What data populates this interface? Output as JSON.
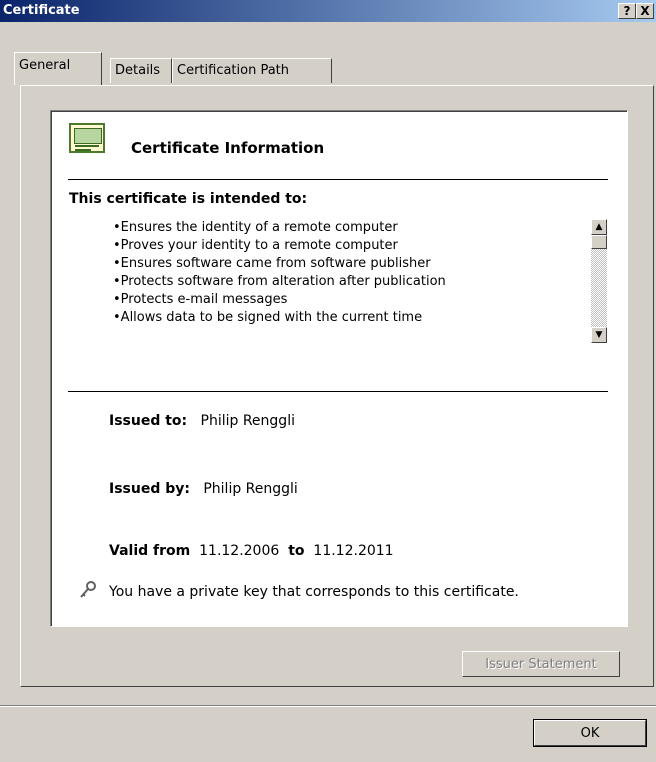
{
  "window": {
    "title": "Certificate",
    "help_label": "?",
    "close_label": "X"
  },
  "tabs": [
    {
      "label": "General"
    },
    {
      "label": "Details"
    },
    {
      "label": "Certification Path"
    }
  ],
  "general": {
    "heading": "Certificate Information",
    "intended_heading": "This certificate is intended to:",
    "purposes": [
      "Ensures the identity of a remote computer",
      "Proves your identity to a remote computer",
      "Ensures software came from software publisher",
      "Protects software from alteration after publication",
      "Protects e-mail messages",
      "Allows data to be signed with the current time"
    ],
    "issued_to_label": "Issued to:",
    "issued_to_value": "Philip Renggli",
    "issued_by_label": "Issued by:",
    "issued_by_value": "Philip Renggli",
    "valid_from_label": "Valid from",
    "valid_from_value": "11.12.2006",
    "valid_to_label": "to",
    "valid_to_value": "11.12.2011",
    "private_key_note": "You have a private key that corresponds to this certificate."
  },
  "buttons": {
    "issuer_statement": "Issuer Statement",
    "ok": "OK"
  },
  "icons": {
    "certificate": "certificate-icon",
    "key": "key-icon"
  }
}
